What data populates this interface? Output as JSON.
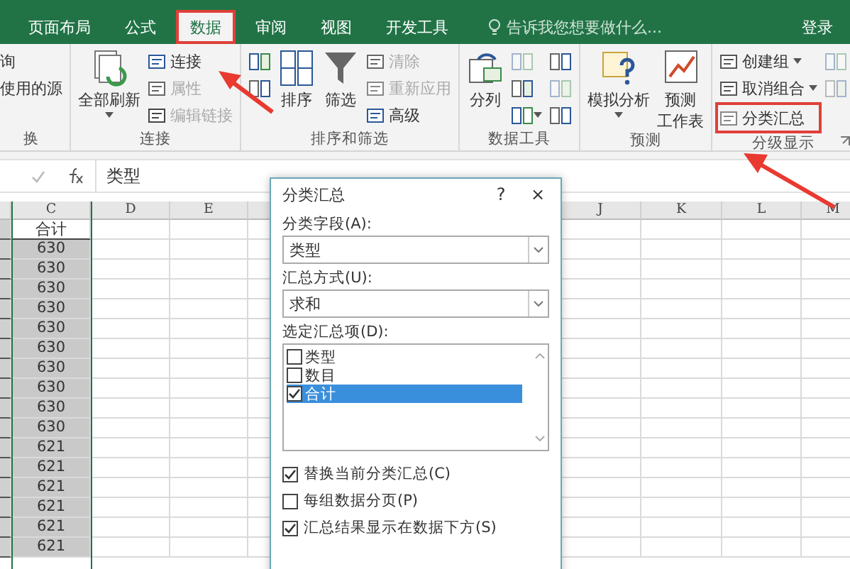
{
  "tabs": [
    {
      "label": "页面布局",
      "selected": false
    },
    {
      "label": "公式",
      "selected": false
    },
    {
      "label": "数据",
      "selected": true
    },
    {
      "label": "审阅",
      "selected": false
    },
    {
      "label": "视图",
      "selected": false
    },
    {
      "label": "开发工具",
      "selected": false
    }
  ],
  "tell_me": {
    "placeholder": "告诉我您想要做什么..."
  },
  "sign_in": "登录",
  "ribbon": {
    "groups": [
      {
        "label": "换",
        "columns": [
          [
            {
              "kind": "text",
              "label": "询",
              "disabled": false,
              "dropdown": false
            },
            {
              "kind": "text",
              "label": "使用的源",
              "disabled": false,
              "dropdown": false
            }
          ]
        ]
      },
      {
        "label": "连接",
        "columns": [
          [
            {
              "kind": "large",
              "label": "全部刷新",
              "disabled": false,
              "dropdown": true
            }
          ],
          [
            {
              "kind": "small",
              "label": "连接",
              "disabled": false,
              "dropdown": false
            },
            {
              "kind": "small",
              "label": "属性",
              "disabled": true,
              "dropdown": false
            },
            {
              "kind": "small",
              "label": "编辑链接",
              "disabled": true,
              "dropdown": false
            }
          ]
        ]
      },
      {
        "label": "排序和筛选",
        "columns": [
          [
            {
              "kind": "icon",
              "disabled": false,
              "dropdown": false
            },
            {
              "kind": "icon",
              "disabled": false,
              "dropdown": false
            }
          ],
          [
            {
              "kind": "large",
              "label": "排序",
              "disabled": false,
              "dropdown": false
            }
          ],
          [
            {
              "kind": "large",
              "label": "筛选",
              "disabled": false,
              "dropdown": false
            }
          ],
          [
            {
              "kind": "small",
              "label": "清除",
              "disabled": true,
              "dropdown": false
            },
            {
              "kind": "small",
              "label": "重新应用",
              "disabled": true,
              "dropdown": false
            },
            {
              "kind": "small",
              "label": "高级",
              "disabled": false,
              "dropdown": false
            }
          ]
        ]
      },
      {
        "label": "数据工具",
        "columns": [
          [
            {
              "kind": "large",
              "label": "分列",
              "disabled": false,
              "dropdown": false
            }
          ],
          [
            {
              "kind": "icon",
              "disabled": true,
              "dropdown": false
            },
            {
              "kind": "icon",
              "disabled": false,
              "dropdown": false
            },
            {
              "kind": "icon",
              "disabled": false,
              "dropdown": true
            }
          ],
          [
            {
              "kind": "icon",
              "disabled": false,
              "dropdown": false
            },
            {
              "kind": "icon",
              "disabled": true,
              "dropdown": false
            },
            {
              "kind": "icon",
              "disabled": false,
              "dropdown": false
            }
          ]
        ]
      },
      {
        "label": "预测",
        "columns": [
          [
            {
              "kind": "large",
              "label": "模拟分析",
              "disabled": false,
              "dropdown": true
            }
          ],
          [
            {
              "kind": "large",
              "lines": [
                "预测",
                "工作表"
              ],
              "disabled": false,
              "dropdown": false
            }
          ]
        ]
      },
      {
        "label": "分级显示",
        "columns": [
          [
            {
              "kind": "small",
              "label": "创建组",
              "disabled": false,
              "dropdown": true
            },
            {
              "kind": "small",
              "label": "取消组合",
              "disabled": false,
              "dropdown": true
            },
            {
              "kind": "small",
              "label": "分类汇总",
              "disabled": false,
              "dropdown": false
            }
          ],
          [
            {
              "kind": "icon",
              "disabled": true,
              "dropdown": false
            },
            {
              "kind": "icon",
              "disabled": true,
              "dropdown": false
            }
          ]
        ]
      }
    ]
  },
  "formula_bar": {
    "value": "类型"
  },
  "sheet": {
    "columns": [
      "",
      "C",
      "D",
      "E",
      "",
      "J",
      "K",
      "L",
      "M"
    ],
    "rows": [
      "合计",
      "630",
      "630",
      "630",
      "630",
      "630",
      "630",
      "630",
      "630",
      "630",
      "630",
      "621",
      "621",
      "621",
      "621",
      "621",
      "621"
    ]
  },
  "dialog": {
    "title": "分类汇总",
    "help": "?",
    "close": "×",
    "fields": [
      {
        "label": "分类字段(A):",
        "value": "类型"
      },
      {
        "label": "汇总方式(U):",
        "value": "求和"
      }
    ],
    "list_label": "选定汇总项(D):",
    "items": [
      {
        "label": "类型",
        "checked": false,
        "selected": false
      },
      {
        "label": "数目",
        "checked": false,
        "selected": false
      },
      {
        "label": "合计",
        "checked": true,
        "selected": true
      }
    ],
    "options": [
      {
        "label": "替换当前分类汇总(C)",
        "checked": true
      },
      {
        "label": "每组数据分页(P)",
        "checked": false
      },
      {
        "label": "汇总结果显示在数据下方(S)",
        "checked": true
      }
    ]
  }
}
